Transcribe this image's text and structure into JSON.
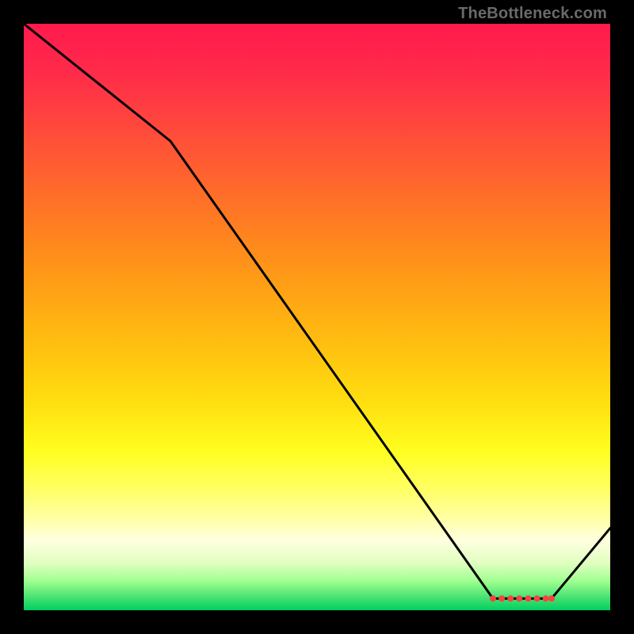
{
  "watermark": "TheBottleneck.com",
  "chart_data": {
    "type": "line",
    "title": "",
    "xlabel": "",
    "ylabel": "",
    "xlim": [
      0,
      100
    ],
    "ylim": [
      0,
      100
    ],
    "series": [
      {
        "name": "curve",
        "x": [
          0,
          25,
          80,
          90,
          100
        ],
        "values": [
          100,
          80,
          2,
          2,
          14
        ]
      }
    ],
    "markers": {
      "name": "flat-region-dots",
      "x": [
        80,
        81.5,
        83,
        84.5,
        86,
        87.5,
        89,
        90
      ],
      "values": [
        2,
        2,
        2,
        2,
        2,
        2,
        2,
        2
      ]
    },
    "colors": {
      "gradient_top": "#ff1a4d",
      "gradient_bottom": "#00d060",
      "line": "#000000",
      "marker": "#ff4040"
    }
  }
}
